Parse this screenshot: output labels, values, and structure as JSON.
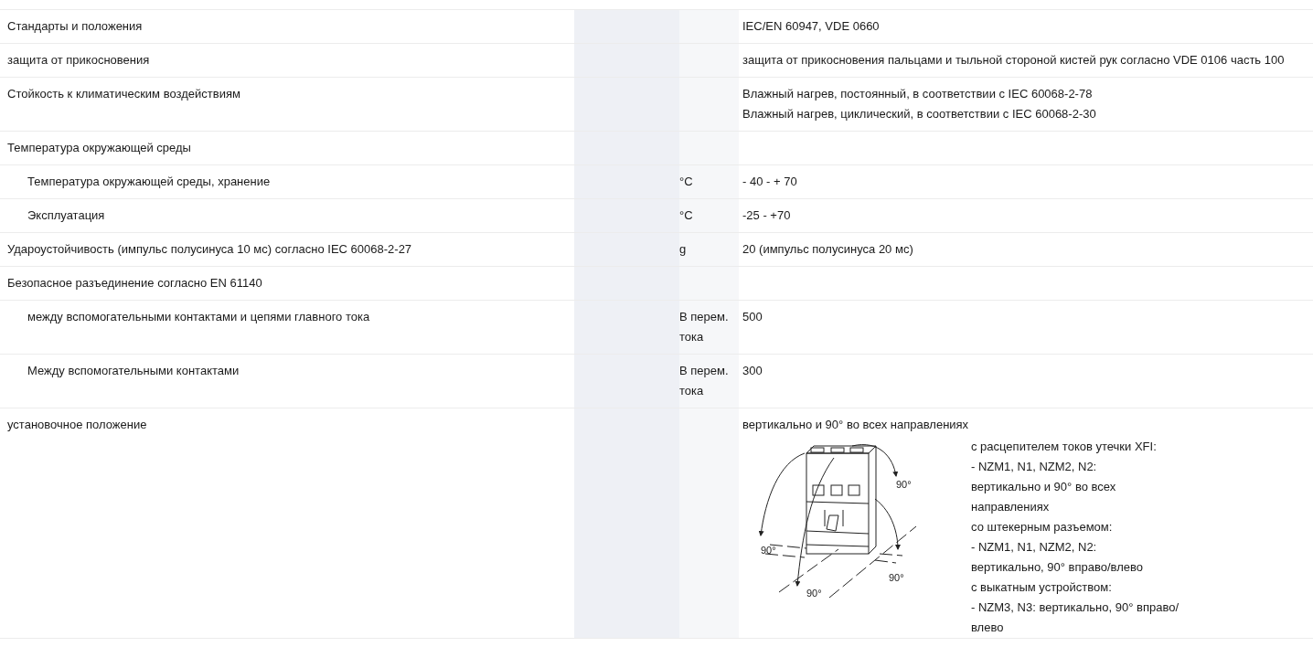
{
  "rows": [
    {
      "label": "Стандарты и положения",
      "value_lines": [
        "IEC/EN 60947, VDE 0660"
      ]
    },
    {
      "label": "защита от прикосновения",
      "value_lines": [
        "защита от прикосновения пальцами и тыльной стороной кистей рук согласно VDE 0106 часть 100"
      ]
    },
    {
      "label": "Стойкость к климатическим воздействиям",
      "value_lines": [
        "Влажный нагрев, постоянный, в соответствии с IEC 60068-2-78",
        "Влажный нагрев, циклический, в соответствии с IEC 60068-2-30"
      ]
    },
    {
      "label": "Температура окружающей среды",
      "children": [
        {
          "label": "Температура окружающей среды, хранение",
          "unit": "°C",
          "value_lines": [
            "- 40 - + 70"
          ]
        },
        {
          "label": "Эксплуатация",
          "unit": "°C",
          "value_lines": [
            "-25 - +70"
          ]
        }
      ]
    },
    {
      "label": "Удароустойчивость (импульс полусинуса 10 мс) согласно IEC 60068-2-27",
      "unit": "g",
      "value_lines": [
        "20 (импульс полусинуса 20 мс)"
      ]
    },
    {
      "label": "Безопасное разъединение согласно EN 61140",
      "children": [
        {
          "label": "между вспомогательными контактами и цепями главного тока",
          "unit": "В перем. тока",
          "value_lines": [
            "500"
          ]
        },
        {
          "label": "Между вспомогательными контактами",
          "unit": "В перем. тока",
          "value_lines": [
            "300"
          ]
        }
      ]
    },
    {
      "label": "установочное положение",
      "value_lines": [
        "вертикально и 90° во всех направлениях"
      ],
      "diagram": {
        "angle_labels": [
          "90°",
          "90°",
          "90°",
          "90°"
        ],
        "notes": [
          "с расцепителем токов утечки XFI:",
          "- NZM1, N1, NZM2, N2:",
          "вертикально и 90° во всех направлениях",
          "со штекерным разъемом:",
          "- NZM1, N1, NZM2, N2:",
          "вертикально, 90° вправо/влево",
          "с выкатным устройством:",
          "- NZM3, N3: вертикально, 90° вправо/влево"
        ]
      }
    }
  ]
}
